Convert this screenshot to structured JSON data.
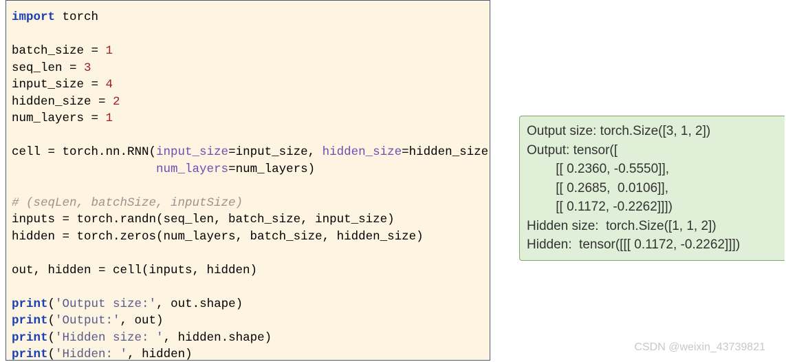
{
  "code": {
    "import_kw": "import",
    "torch": "torch",
    "bs_var": "batch_size",
    "bs_eq": " = ",
    "bs_val": "1",
    "sl_var": "seq_len",
    "sl_val": "3",
    "is_var": "input_size",
    "is_val": "4",
    "hs_var": "hidden_size",
    "hs_val": "2",
    "nl_var": "num_layers",
    "nl_val": "1",
    "cell_assign": "cell = torch.nn.RNN(",
    "arg_is": "input_size",
    "eq_is": "=input_size, ",
    "arg_hs": "hidden_size",
    "eq_hs": "=hidden_size,",
    "indent": "                    ",
    "arg_nl": "num_layers",
    "eq_nl": "=num_layers)",
    "comment": "# (seqLen, batchSize, inputSize)",
    "inputs_line": "inputs = torch.randn(seq_len, batch_size, input_size)",
    "hidden_line": "hidden = torch.zeros(num_layers, batch_size, hidden_size)",
    "call_line": "out, hidden = cell(inputs, hidden)",
    "print_kw": "print",
    "p1_str": "'Output size:'",
    "p1_arg": ", out.shape)",
    "p2_str": "'Output:'",
    "p2_arg": ", out)",
    "p3_str": "'Hidden size: '",
    "p3_arg": ", hidden.shape)",
    "p4_str": "'Hidden: '",
    "p4_arg": ", hidden)"
  },
  "output": {
    "l1": "Output size: torch.Size([3, 1, 2])",
    "l2": "Output: tensor([",
    "l3": "        [[ 0.2360, -0.5550]],",
    "l4": "        [[ 0.2685,  0.0106]],",
    "l5": "        [[ 0.1172, -0.2262]]])",
    "l6": "Hidden size:  torch.Size([1, 1, 2])",
    "l7": "Hidden:  tensor([[[ 0.1172, -0.2262]]])"
  },
  "watermark": "CSDN @weixin_43739821"
}
